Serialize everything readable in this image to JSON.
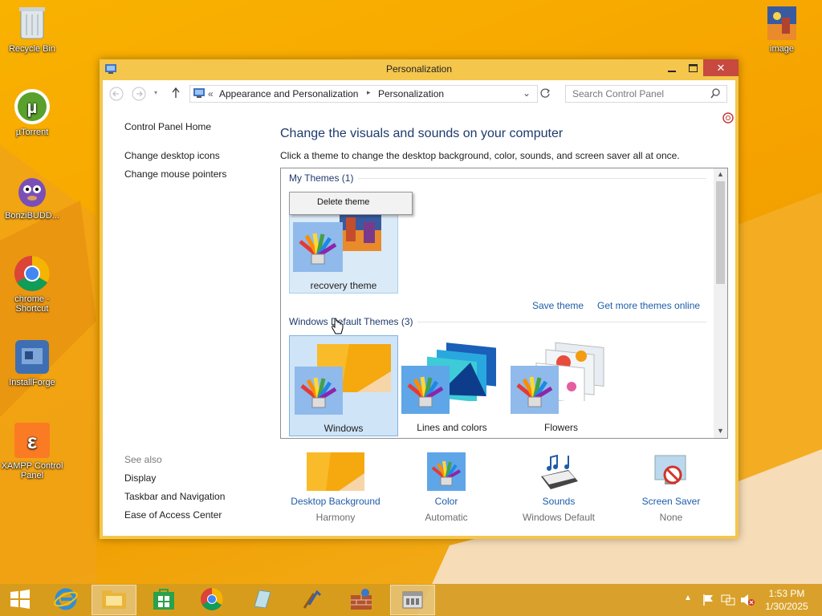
{
  "desktop": {
    "icons": [
      {
        "label": "Recycle Bin"
      },
      {
        "label": "µTorrent"
      },
      {
        "label": "BonziBUDD..."
      },
      {
        "label": "chrome - Shortcut"
      },
      {
        "label": "InstallForge"
      },
      {
        "label": "XAMPP Control Panel"
      },
      {
        "label": "image"
      }
    ]
  },
  "window": {
    "title": "Personalization",
    "breadcrumb": {
      "sep": "«",
      "item1": "Appearance and Personalization",
      "arrow": "▸",
      "item2": "Personalization"
    },
    "search_placeholder": "Search Control Panel",
    "left": {
      "home": "Control Panel Home",
      "link1": "Change desktop icons",
      "link2": "Change mouse pointers",
      "see_also": "See also",
      "also1": "Display",
      "also2": "Taskbar and Navigation",
      "also3": "Ease of Access Center"
    },
    "heading": "Change the visuals and sounds on your computer",
    "subheading": "Click a theme to change the desktop background, color, sounds, and screen saver all at once.",
    "my_themes": "My Themes (1)",
    "context_menu": "Delete theme",
    "recovery_theme": "recovery theme",
    "save_theme": "Save theme",
    "more_themes": "Get more themes online",
    "default_themes": "Windows Default Themes (3)",
    "default_list": [
      {
        "label": "Windows"
      },
      {
        "label": "Lines and colors"
      },
      {
        "label": "Flowers"
      }
    ],
    "bottom": [
      {
        "title": "Desktop Background",
        "value": "Harmony"
      },
      {
        "title": "Color",
        "value": "Automatic"
      },
      {
        "title": "Sounds",
        "value": "Windows Default"
      },
      {
        "title": "Screen Saver",
        "value": "None"
      }
    ]
  },
  "taskbar": {
    "time": "1:53 PM",
    "date": "1/30/2025"
  }
}
